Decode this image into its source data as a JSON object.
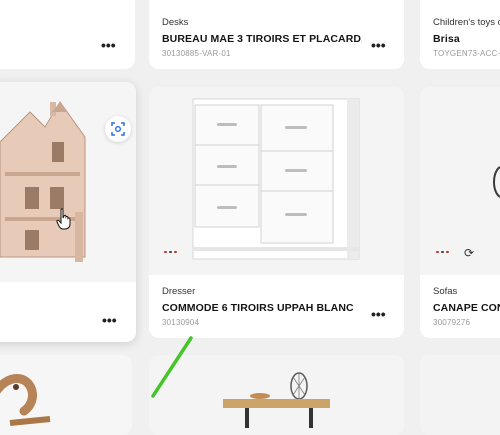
{
  "cards": [
    {
      "category": "Desks",
      "title": "BUREAU MAE 3 TIROIRS ET PLACARD...",
      "sku": "30130885-VAR-01"
    },
    {
      "category": "Children's toys c",
      "title": "Brisa",
      "sku": "TOYGEN73-ACC-"
    },
    {
      "category": "Dresser",
      "title": "COMMODE 6 TIROIRS UPPAH BLANC",
      "sku": "30130904"
    },
    {
      "category": "Sofas",
      "title": "CANAPE CON",
      "sku": "30079276"
    }
  ],
  "more_label": "•••",
  "refresh_glyph": "⟳",
  "colors": {
    "accent": "#2f6de1",
    "swatch_red": "#c8312f",
    "swatch_dark": "#444444",
    "annotation_green": "#46c52a"
  },
  "icons": {
    "scan": "scan-icon",
    "more": "more-options-icon",
    "refresh": "refresh-icon",
    "cursor": "hand-cursor-icon"
  }
}
